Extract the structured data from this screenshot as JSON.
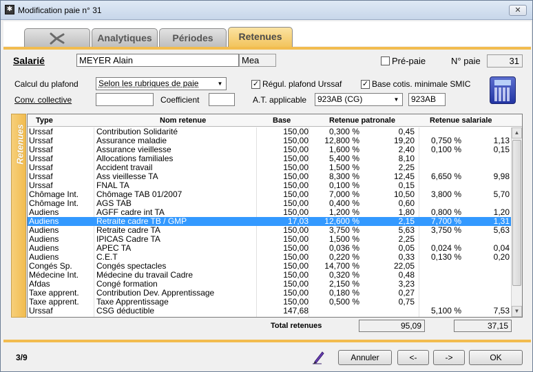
{
  "window": {
    "title": "Modification paie n° 31",
    "close_label": "✕",
    "app_icon": "app-icon"
  },
  "tabs": [
    {
      "label": "",
      "icon": "logo-icon"
    },
    {
      "label": "Analytiques"
    },
    {
      "label": "Périodes"
    },
    {
      "label": "Retenues",
      "active": true
    }
  ],
  "header": {
    "salarie_label": "Salarié",
    "salarie_value": "MEYER Alain",
    "salarie_code": "Mea",
    "prepaie_label": "Pré-paie",
    "prepaie_checked": false,
    "npaie_label": "N° paie",
    "npaie_value": "31",
    "calcul_label": "Calcul du plafond",
    "calcul_value": "Selon les rubriques de paie",
    "regul_label": "Régul. plafond Urssaf",
    "regul_checked": true,
    "base_smic_label": "Base cotis. minimale SMIC",
    "base_smic_checked": true,
    "conv_label": "Conv. collective",
    "conv_value": "",
    "coef_label": "Coefficient",
    "coef_value": "",
    "at_label": "A.T. applicable",
    "at_value": "923AB (CG)",
    "at_code": "923AB"
  },
  "side_label": "Retenues",
  "columns": {
    "type": "Type",
    "nom": "Nom retenue",
    "base": "Base",
    "patronale": "Retenue patronale",
    "salariale": "Retenue salariale"
  },
  "rows": [
    {
      "type": "Urssaf",
      "nom": "Contribution Solidarité",
      "base": "150,00",
      "tp": "0,300 %",
      "mp": "0,45",
      "ts": "",
      "ms": ""
    },
    {
      "type": "Urssaf",
      "nom": "Assurance maladie",
      "base": "150,00",
      "tp": "12,800 %",
      "mp": "19,20",
      "ts": "0,750 %",
      "ms": "1,13"
    },
    {
      "type": "Urssaf",
      "nom": "Assurance vieillesse",
      "base": "150,00",
      "tp": "1,600 %",
      "mp": "2,40",
      "ts": "0,100 %",
      "ms": "0,15"
    },
    {
      "type": "Urssaf",
      "nom": "Allocations familiales",
      "base": "150,00",
      "tp": "5,400 %",
      "mp": "8,10",
      "ts": "",
      "ms": ""
    },
    {
      "type": "Urssaf",
      "nom": "Accident travail",
      "base": "150,00",
      "tp": "1,500 %",
      "mp": "2,25",
      "ts": "",
      "ms": ""
    },
    {
      "type": "Urssaf",
      "nom": "Ass vieillesse TA",
      "base": "150,00",
      "tp": "8,300 %",
      "mp": "12,45",
      "ts": "6,650 %",
      "ms": "9,98"
    },
    {
      "type": "Urssaf",
      "nom": "FNAL TA",
      "base": "150,00",
      "tp": "0,100 %",
      "mp": "0,15",
      "ts": "",
      "ms": ""
    },
    {
      "type": "Chômage Int.",
      "nom": "Chômage TAB 01/2007",
      "base": "150,00",
      "tp": "7,000 %",
      "mp": "10,50",
      "ts": "3,800 %",
      "ms": "5,70"
    },
    {
      "type": "Chômage Int.",
      "nom": "AGS TAB",
      "base": "150,00",
      "tp": "0,400 %",
      "mp": "0,60",
      "ts": "",
      "ms": ""
    },
    {
      "type": "Audiens",
      "nom": "AGFF cadre int TA",
      "base": "150,00",
      "tp": "1,200 %",
      "mp": "1,80",
      "ts": "0,800 %",
      "ms": "1,20"
    },
    {
      "type": "Audiens",
      "nom": "Retraite cadre TB / GMP",
      "base": "17,03",
      "tp": "12,600 %",
      "mp": "2,15",
      "ts": "7,700 %",
      "ms": "1,31",
      "selected": true
    },
    {
      "type": "Audiens",
      "nom": "Retraite cadre TA",
      "base": "150,00",
      "tp": "3,750 %",
      "mp": "5,63",
      "ts": "3,750 %",
      "ms": "5,63"
    },
    {
      "type": "Audiens",
      "nom": "IPICAS Cadre TA",
      "base": "150,00",
      "tp": "1,500 %",
      "mp": "2,25",
      "ts": "",
      "ms": ""
    },
    {
      "type": "Audiens",
      "nom": "APEC TA",
      "base": "150,00",
      "tp": "0,036 %",
      "mp": "0,05",
      "ts": "0,024 %",
      "ms": "0,04"
    },
    {
      "type": "Audiens",
      "nom": "C.E.T",
      "base": "150,00",
      "tp": "0,220 %",
      "mp": "0,33",
      "ts": "0,130 %",
      "ms": "0,20"
    },
    {
      "type": "Congés Sp.",
      "nom": "Congés spectacles",
      "base": "150,00",
      "tp": "14,700 %",
      "mp": "22,05",
      "ts": "",
      "ms": ""
    },
    {
      "type": "Médecine Int.",
      "nom": "Médecine du travail Cadre",
      "base": "150,00",
      "tp": "0,320 %",
      "mp": "0,48",
      "ts": "",
      "ms": ""
    },
    {
      "type": "Afdas",
      "nom": "Congé formation",
      "base": "150,00",
      "tp": "2,150 %",
      "mp": "3,23",
      "ts": "",
      "ms": ""
    },
    {
      "type": "Taxe apprent.",
      "nom": "Contribution Dev. Apprentissage",
      "base": "150,00",
      "tp": "0,180 %",
      "mp": "0,27",
      "ts": "",
      "ms": ""
    },
    {
      "type": "Taxe apprent.",
      "nom": "Taxe Apprentissage",
      "base": "150,00",
      "tp": "0,500 %",
      "mp": "0,75",
      "ts": "",
      "ms": ""
    },
    {
      "type": "Urssaf",
      "nom": "CSG déductible",
      "base": "147,68",
      "tp": "",
      "mp": "",
      "ts": "5,100 %",
      "ms": "7,53"
    }
  ],
  "totals": {
    "label": "Total retenues",
    "patronale": "95,09",
    "salariale": "37,15"
  },
  "footer": {
    "counter": "3/9",
    "annuler": "Annuler",
    "prev": "<-",
    "next": "->",
    "ok": "OK"
  },
  "colors": {
    "accent": "#f2bc4f",
    "selection": "#3399ff"
  }
}
